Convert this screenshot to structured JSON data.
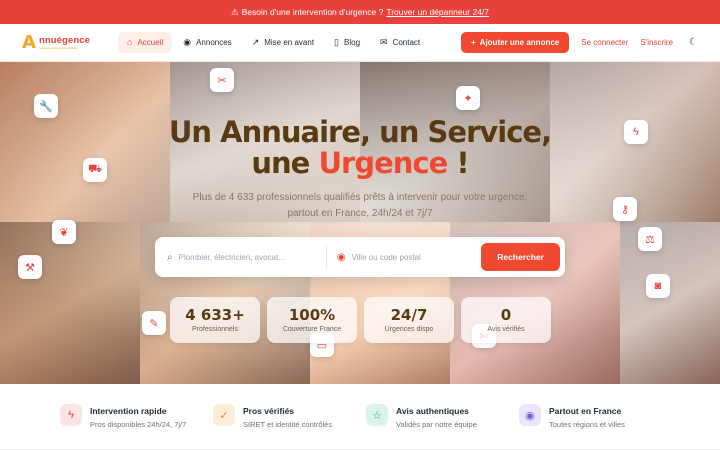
{
  "topbar": {
    "icon": "warning-icon",
    "text": "Besoin d'une intervention d'urgence ?",
    "link": "Trouver un dépanneur 24/7"
  },
  "logo": {
    "mark": "A",
    "word": "nnuégence",
    "tag": "Annuaire des professionnels"
  },
  "nav": {
    "items": [
      {
        "label": "Accueil",
        "icon": "home-icon",
        "active": true
      },
      {
        "label": "Annonces",
        "icon": "map-pin-icon"
      },
      {
        "label": "Mise en avant",
        "icon": "trending-icon"
      },
      {
        "label": "Blog",
        "icon": "book-icon"
      },
      {
        "label": "Contact",
        "icon": "mail-icon"
      }
    ],
    "cta": "Ajouter une annonce",
    "login": "Se connecter",
    "signup": "S'inscrire"
  },
  "hero": {
    "title_line1": "Un Annuaire, un Service,",
    "title_line2_a": "une",
    "title_line2_urgence": "Urgence",
    "title_line2_b": "!",
    "subtitle": "Plus de 4 633 professionnels qualifiés prêts à intervenir pour votre urgence, partout en France, 24h/24 et 7j/7"
  },
  "search": {
    "what_placeholder": "Plombier, électricien, avocat...",
    "where_placeholder": "Ville ou code postal",
    "button": "Rechercher"
  },
  "stats": [
    {
      "value": "4 633+",
      "label": "Professionnels"
    },
    {
      "value": "100%",
      "label": "Couverture France"
    },
    {
      "value": "24/7",
      "label": "Urgences dispo"
    },
    {
      "value": "0",
      "label": "Avis vérifiés"
    }
  ],
  "features": [
    {
      "title": "Intervention rapide",
      "desc": "Pros disponibles 24h/24, 7j/7",
      "icon": "lightning-icon"
    },
    {
      "title": "Pros vérifiés",
      "desc": "SIRET et identité contrôlés",
      "icon": "check-circle-icon"
    },
    {
      "title": "Avis authentiques",
      "desc": "Validés par notre équipe",
      "icon": "star-icon"
    },
    {
      "title": "Partout en France",
      "desc": "Toutes régions et villes",
      "icon": "map-pin-icon"
    }
  ],
  "colors": {
    "accent": "#ef4a2f",
    "brand_dark": "#5b3a12",
    "logo_orange": "#f5a623"
  }
}
